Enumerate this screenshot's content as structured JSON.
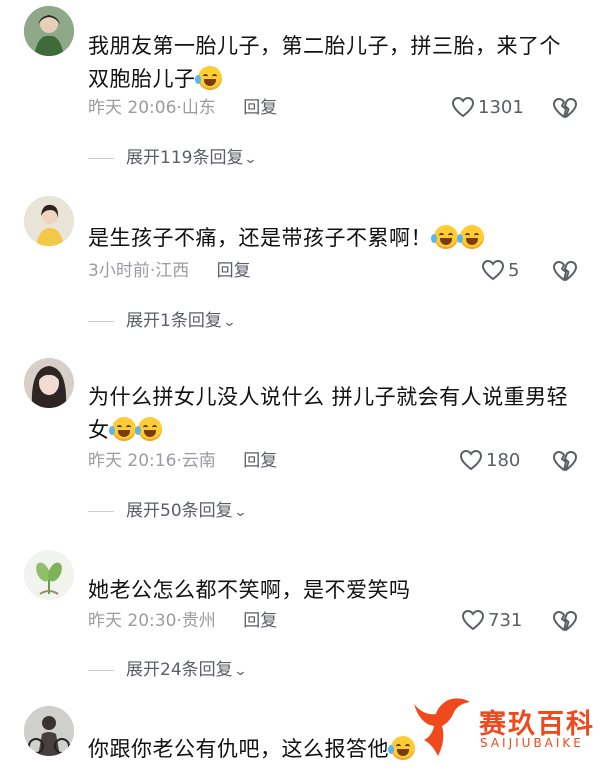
{
  "comments": [
    {
      "text": "我朋友第一胎儿子，第二胎儿子，拼三胎，来了个双胞胎儿子",
      "time": "昨天 20:06",
      "location": "山东",
      "reply_label": "回复",
      "likes": "1301",
      "expand_label": "展开119条回复",
      "avatar_icon": "avatar-green-dress"
    },
    {
      "text": "是生孩子不痛，还是带孩子不累啊！",
      "time": "3小时前",
      "location": "江西",
      "reply_label": "回复",
      "likes": "5",
      "expand_label": "展开1条回复",
      "avatar_icon": "avatar-girl-yellow"
    },
    {
      "text": "为什么拼女儿没人说什么 拼儿子就会有人说重男轻女",
      "time": "昨天 20:16",
      "location": "云南",
      "reply_label": "回复",
      "likes": "180",
      "expand_label": "展开50条回复",
      "avatar_icon": "avatar-dark-hair"
    },
    {
      "text": "她老公怎么都不笑啊，是不爱笑吗",
      "time": "昨天 20:30",
      "location": "贵州",
      "reply_label": "回复",
      "likes": "731",
      "expand_label": "展开24条回复",
      "avatar_icon": "avatar-plant-drawing"
    },
    {
      "text": "你跟你老公有仇吧，这么报答他",
      "avatar_icon": "avatar-person-bike"
    }
  ],
  "watermark": {
    "name": "赛玖百科",
    "pinyin": "SAIJIUBAIKE",
    "color": "#f04a1c"
  },
  "icons": {
    "like": "heart-outline-icon",
    "dislike": "broken-heart-icon",
    "expand": "chevron-down-icon",
    "emoji": "laughing-tears-emoji"
  }
}
